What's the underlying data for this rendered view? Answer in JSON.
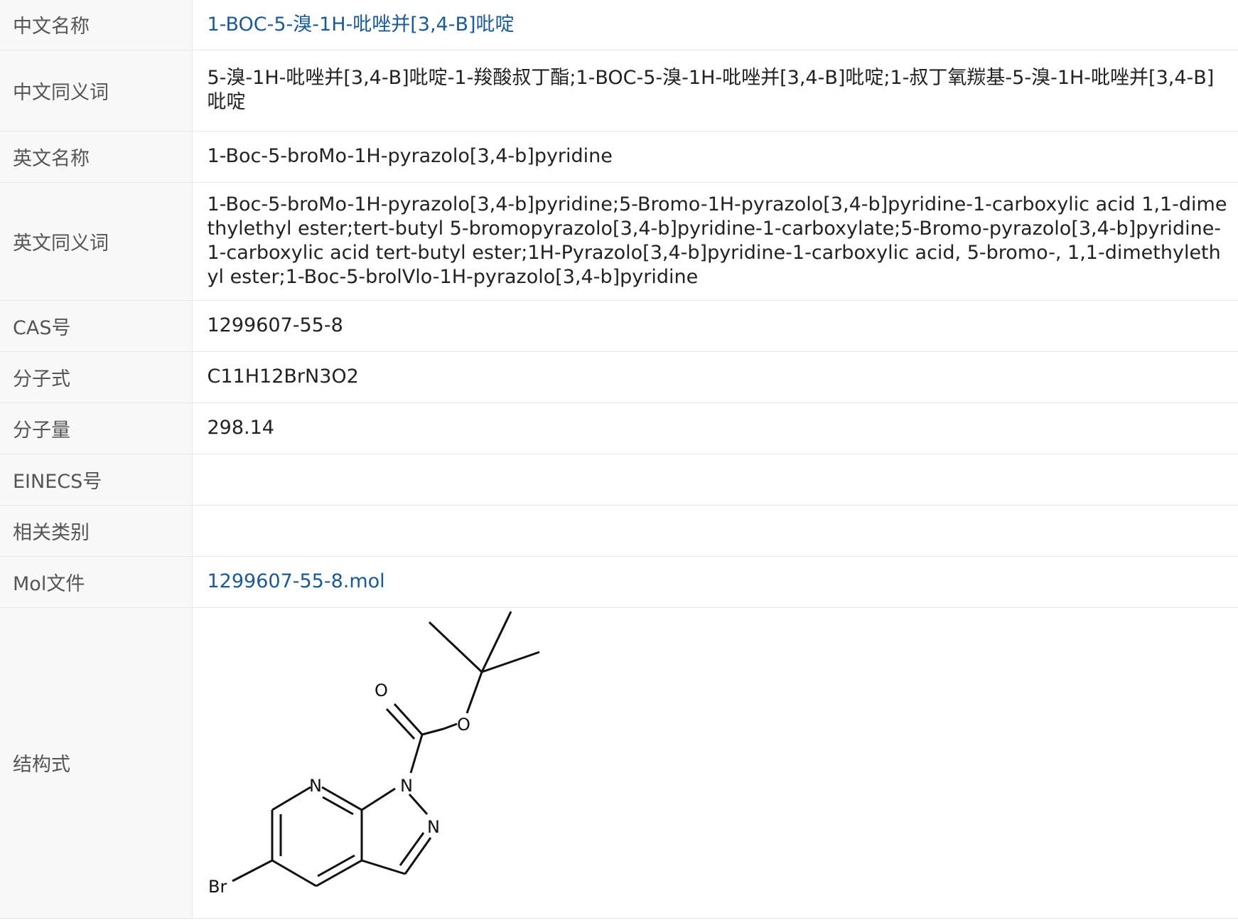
{
  "rows": [
    {
      "label": "中文名称",
      "value": "1-BOC-5-溴-1H-吡唑并[3,4-B]吡啶",
      "link": true
    },
    {
      "label": "中文同义词",
      "value": "5-溴-1H-吡唑并[3,4-B]吡啶-1-羧酸叔丁酯;1-BOC-5-溴-1H-吡唑并[3,4-B]吡啶;1-叔丁氧羰基-5-溴-1H-吡唑并[3,4-B]吡啶"
    },
    {
      "label": "英文名称",
      "value": "1-Boc-5-broMo-1H-pyrazolo[3,4-b]pyridine"
    },
    {
      "label": "英文同义词",
      "value": "1-Boc-5-broMo-1H-pyrazolo[3,4-b]pyridine;5-Bromo-1H-pyrazolo[3,4-b]pyridine-1-carboxylic acid 1,1-dimethylethyl ester;tert-butyl 5-bromopyrazolo[3,4-b]pyridine-1-carboxylate;5-Bromo-pyrazolo[3,4-b]pyridine-1-carboxylic acid tert-butyl ester;1H-Pyrazolo[3,4-b]pyridine-1-carboxylic acid, 5-bromo-, 1,1-dimethylethyl ester;1-Boc-5-brolVlo-1H-pyrazolo[3,4-b]pyridine"
    },
    {
      "label": "CAS号",
      "value": "1299607-55-8"
    },
    {
      "label": "分子式",
      "value": "C11H12BrN3O2"
    },
    {
      "label": "分子量",
      "value": "298.14"
    },
    {
      "label": "EINECS号",
      "value": ""
    },
    {
      "label": "相关类别",
      "value": ""
    },
    {
      "label": "Mol文件",
      "value": "1299607-55-8.mol",
      "link": true
    },
    {
      "label": "结构式",
      "value": ""
    }
  ],
  "structure_atoms": {
    "o_top": "O",
    "o_ester": "O",
    "n1": "N",
    "n2": "N",
    "n_pyr": "N",
    "br": "Br"
  },
  "colors": {
    "link": "#1a5a96",
    "label_bg": "#f8f8f8",
    "border": "#e6e6e6"
  }
}
